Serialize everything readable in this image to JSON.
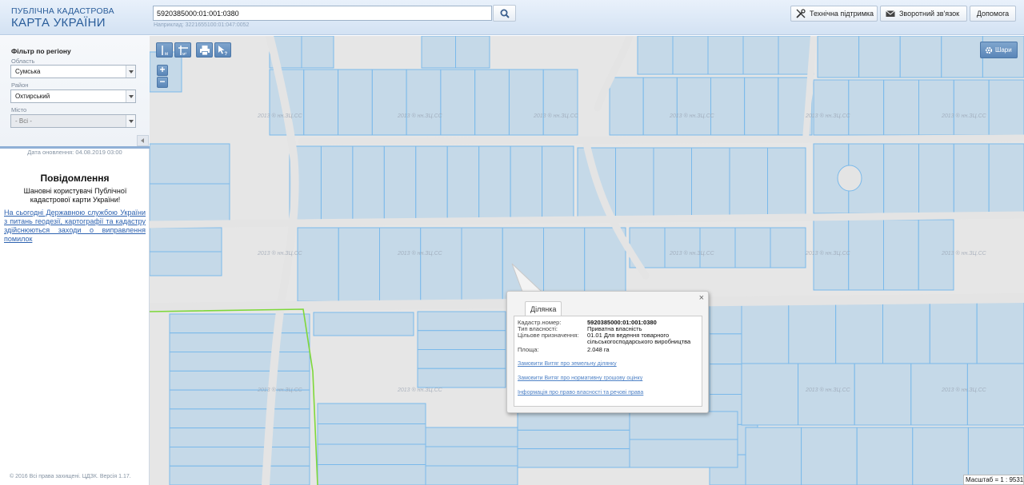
{
  "header": {
    "logo_line1": "ПУБЛІЧНА КАДАСТРОВА",
    "logo_line2": "КАРТА УКРАЇНИ",
    "search_value": "5920385000:01:001:0380",
    "search_hint": "Наприклад: 3221655100:01:047:0052",
    "buttons": {
      "support": "Технічна підтримка",
      "feedback": "Зворотний зв'язок",
      "help": "Допомога"
    }
  },
  "sidebar": {
    "filter_title": "Фільтр по регіону",
    "region_label": "Область",
    "region_value": "Сумська",
    "district_label": "Район",
    "district_value": "Охтирський",
    "city_label": "Місто",
    "city_value": "- Всі -",
    "update_date": "Дата оновлення: 04.08.2019 03:00",
    "notice_title": "Повідомлення",
    "notice_body": "Шановні користувачі Публічної кадастрової карти України!",
    "notice_link": "На сьогодні Державною службою України з питань геодезії, картографії та кадастру здійснюються заходи о виправлення помилок",
    "copyright": "© 2016 Всі права захищені. ЦДЗК. Версія 1.17."
  },
  "map": {
    "layers_label": "Шари",
    "zoom_in": "+",
    "zoom_out": "−",
    "scale_text": "Масштаб = 1 : 9531",
    "watermark": "2013 ® нн.ЗЦ.СС",
    "colors": {
      "parcel_fill": "#c5d9e8",
      "parcel_stroke": "#7ab9ea",
      "road": "#e4e4e4",
      "boundary": "#7ed83a"
    }
  },
  "popup": {
    "tab_label": "Ділянка",
    "close": "×",
    "fields": [
      {
        "key": "Кадастр.номер:",
        "value": "5920385000:01:001:0380",
        "bold": true
      },
      {
        "key": "Тип власності:",
        "value": "Приватна власність",
        "bold": false
      },
      {
        "key": "Цільове призначення:",
        "value": "01.01 Для ведення товарного сільськогосподарського виробництва",
        "bold": false
      },
      {
        "key": "Площа:",
        "value": "2.048 га",
        "bold": false
      }
    ],
    "links": [
      "Замовити Витяг про земельну ділянку",
      "Замовити Витяг про нормативну грошову оцінку",
      "Інформація про право власності та речові права"
    ]
  }
}
